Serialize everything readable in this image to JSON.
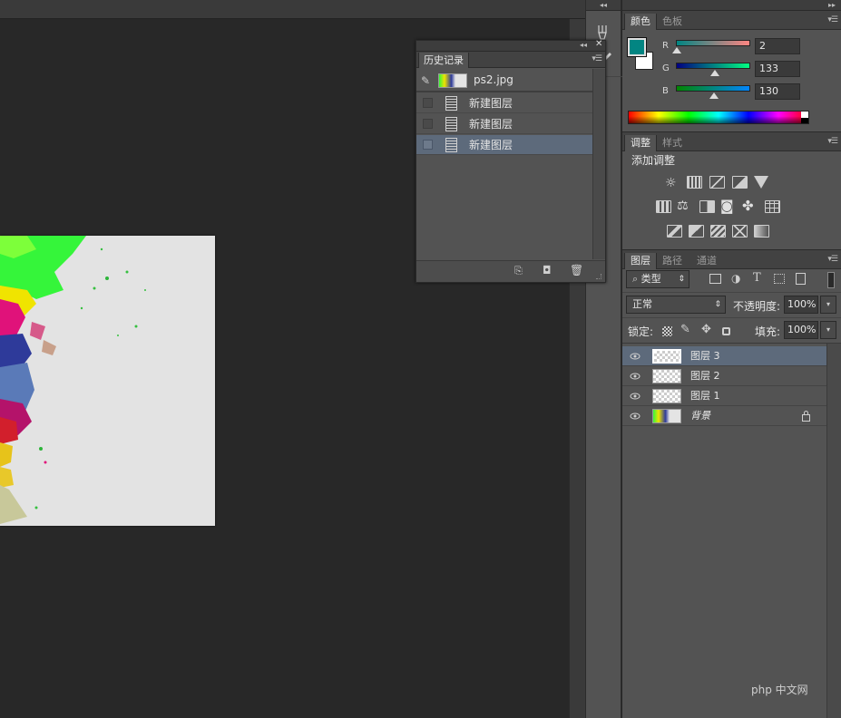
{
  "history": {
    "title": "历史记录",
    "snapshot_label": "ps2.jpg",
    "steps": [
      "新建图层",
      "新建图层",
      "新建图层"
    ],
    "selected_step": 2
  },
  "color_panel": {
    "tabs": [
      "颜色",
      "色板"
    ],
    "active_tab": 0,
    "foreground_color": "#028582",
    "channels": [
      {
        "label": "R",
        "value": "2"
      },
      {
        "label": "G",
        "value": "133"
      },
      {
        "label": "B",
        "value": "130"
      }
    ]
  },
  "adjust_panel": {
    "tabs": [
      "调整",
      "样式"
    ],
    "active_tab": 0,
    "heading": "添加调整"
  },
  "layers_panel": {
    "tabs": [
      "图层",
      "路径",
      "通道"
    ],
    "active_tab": 0,
    "filter_label": "类型",
    "blend_mode": "正常",
    "opacity_label": "不透明度:",
    "opacity_value": "100%",
    "lock_label": "锁定:",
    "fill_label": "填充:",
    "fill_value": "100%",
    "layers": [
      {
        "name": "图层 3",
        "selected": true
      },
      {
        "name": "图层 2",
        "selected": false
      },
      {
        "name": "图层 1",
        "selected": false
      },
      {
        "name": "背景",
        "selected": false,
        "locked": true
      }
    ]
  },
  "watermark": "php 中文网",
  "colors": {
    "selection": "#5d6a7b",
    "panel_bg": "#535353",
    "workspace_bg": "#282828"
  }
}
